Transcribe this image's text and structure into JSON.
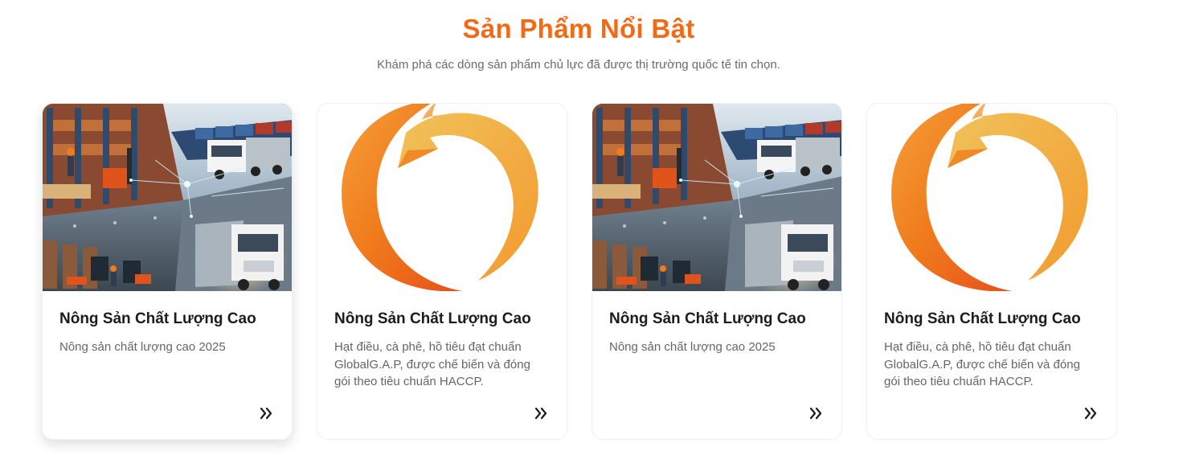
{
  "section": {
    "title": "Sản Phẩm Nổi Bật",
    "subtitle": "Khám phá các dòng sản phẩm chủ lực đã được thị trường quốc tế tin chọn."
  },
  "colors": {
    "accent": "#f26a16",
    "text_dark": "#1c1c1c",
    "text_muted": "#666666"
  },
  "products": [
    {
      "image": "logistics-photo",
      "title": "Nông Sản Chất Lượng Cao",
      "description": "Nông sản chất lượng cao 2025",
      "arrow_icon": "double-chevron-right-icon"
    },
    {
      "image": "swirl-logo",
      "title": "Nông Sản Chất Lượng Cao",
      "description": "Hạt điều, cà phê, hồ tiêu đạt chuẩn GlobalG.A.P, được chế biến và đóng gói theo tiêu chuẩn HACCP.",
      "arrow_icon": "double-chevron-right-icon"
    },
    {
      "image": "logistics-photo",
      "title": "Nông Sản Chất Lượng Cao",
      "description": "Nông sản chất lượng cao 2025",
      "arrow_icon": "double-chevron-right-icon"
    },
    {
      "image": "swirl-logo",
      "title": "Nông Sản Chất Lượng Cao",
      "description": "Hạt điều, cà phê, hồ tiêu đạt chuẩn GlobalG.A.P, được chế biến và đóng gói theo tiêu chuẩn HACCP.",
      "arrow_icon": "double-chevron-right-icon"
    }
  ]
}
